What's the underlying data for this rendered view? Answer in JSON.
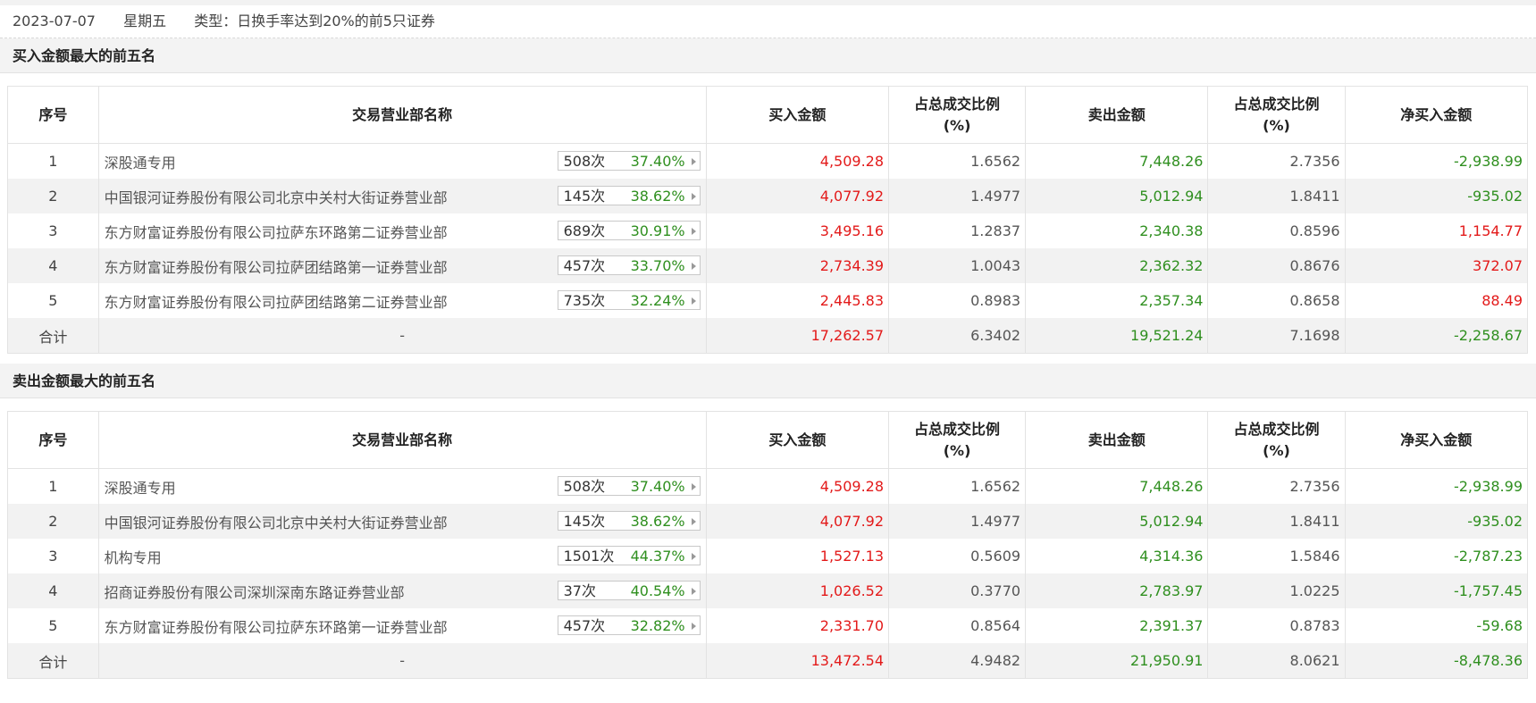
{
  "header": {
    "date": "2023-07-07",
    "weekday": "星期五",
    "type": "类型：日换手率达到20%的前5只证券"
  },
  "columns": {
    "idx": "序号",
    "name": "交易营业部名称",
    "buy": "买入金额",
    "buy_ratio_l1": "占总成交比例",
    "buy_ratio_l2": "(%)",
    "sell": "卖出金额",
    "sell_ratio_l1": "占总成交比例",
    "sell_ratio_l2": "(%)",
    "net": "净买入金额"
  },
  "buy_section": {
    "title": "买入金额最大的前五名",
    "rows": [
      {
        "idx": "1",
        "name": "深股通专用",
        "count": "508次",
        "rate": "37.40%",
        "buy": "4,509.28",
        "buy_ratio": "1.6562",
        "sell": "7,448.26",
        "sell_ratio": "2.7356",
        "net": "-2,938.99",
        "net_color": "green"
      },
      {
        "idx": "2",
        "name": "中国银河证券股份有限公司北京中关村大街证券营业部",
        "count": "145次",
        "rate": "38.62%",
        "buy": "4,077.92",
        "buy_ratio": "1.4977",
        "sell": "5,012.94",
        "sell_ratio": "1.8411",
        "net": "-935.02",
        "net_color": "green"
      },
      {
        "idx": "3",
        "name": "东方财富证券股份有限公司拉萨东环路第二证券营业部",
        "count": "689次",
        "rate": "30.91%",
        "buy": "3,495.16",
        "buy_ratio": "1.2837",
        "sell": "2,340.38",
        "sell_ratio": "0.8596",
        "net": "1,154.77",
        "net_color": "red"
      },
      {
        "idx": "4",
        "name": "东方财富证券股份有限公司拉萨团结路第一证券营业部",
        "count": "457次",
        "rate": "33.70%",
        "buy": "2,734.39",
        "buy_ratio": "1.0043",
        "sell": "2,362.32",
        "sell_ratio": "0.8676",
        "net": "372.07",
        "net_color": "red"
      },
      {
        "idx": "5",
        "name": "东方财富证券股份有限公司拉萨团结路第二证券营业部",
        "count": "735次",
        "rate": "32.24%",
        "buy": "2,445.83",
        "buy_ratio": "0.8983",
        "sell": "2,357.34",
        "sell_ratio": "0.8658",
        "net": "88.49",
        "net_color": "red"
      }
    ],
    "total": {
      "label": "合计",
      "name": "-",
      "buy": "17,262.57",
      "buy_ratio": "6.3402",
      "sell": "19,521.24",
      "sell_ratio": "7.1698",
      "net": "-2,258.67",
      "net_color": "green"
    }
  },
  "sell_section": {
    "title": "卖出金额最大的前五名",
    "rows": [
      {
        "idx": "1",
        "name": "深股通专用",
        "count": "508次",
        "rate": "37.40%",
        "buy": "4,509.28",
        "buy_ratio": "1.6562",
        "sell": "7,448.26",
        "sell_ratio": "2.7356",
        "net": "-2,938.99",
        "net_color": "green"
      },
      {
        "idx": "2",
        "name": "中国银河证券股份有限公司北京中关村大街证券营业部",
        "count": "145次",
        "rate": "38.62%",
        "buy": "4,077.92",
        "buy_ratio": "1.4977",
        "sell": "5,012.94",
        "sell_ratio": "1.8411",
        "net": "-935.02",
        "net_color": "green"
      },
      {
        "idx": "3",
        "name": "机构专用",
        "count": "1501次",
        "rate": "44.37%",
        "buy": "1,527.13",
        "buy_ratio": "0.5609",
        "sell": "4,314.36",
        "sell_ratio": "1.5846",
        "net": "-2,787.23",
        "net_color": "green"
      },
      {
        "idx": "4",
        "name": "招商证券股份有限公司深圳深南东路证券营业部",
        "count": "37次",
        "rate": "40.54%",
        "buy": "1,026.52",
        "buy_ratio": "0.3770",
        "sell": "2,783.97",
        "sell_ratio": "1.0225",
        "net": "-1,757.45",
        "net_color": "green"
      },
      {
        "idx": "5",
        "name": "东方财富证券股份有限公司拉萨东环路第一证券营业部",
        "count": "457次",
        "rate": "32.82%",
        "buy": "2,331.70",
        "buy_ratio": "0.8564",
        "sell": "2,391.37",
        "sell_ratio": "0.8783",
        "net": "-59.68",
        "net_color": "green"
      }
    ],
    "total": {
      "label": "合计",
      "name": "-",
      "buy": "13,472.54",
      "buy_ratio": "4.9482",
      "sell": "21,950.91",
      "sell_ratio": "8.0621",
      "net": "-8,478.36",
      "net_color": "green"
    }
  },
  "colors": {
    "red": "#e31a1a",
    "green": "#2f8f1f",
    "row_alt": "#f2f2f2"
  }
}
